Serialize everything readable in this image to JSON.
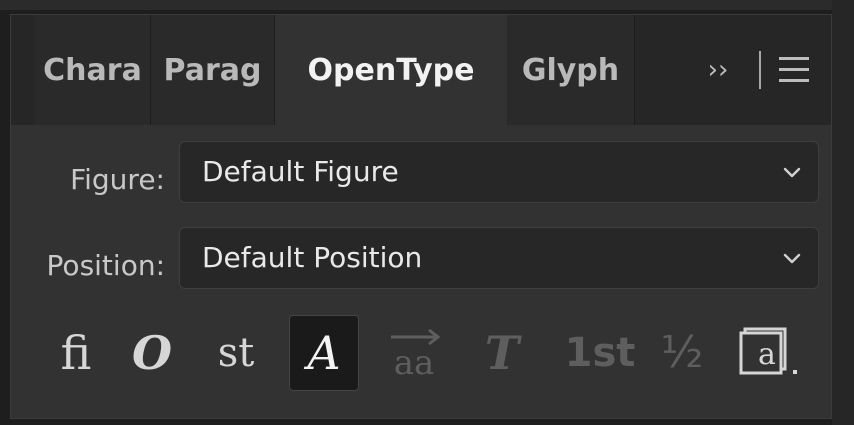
{
  "tabs": [
    {
      "label": "Chara",
      "active": false
    },
    {
      "label": "Parag",
      "active": false
    },
    {
      "label": "OpenType",
      "active": true
    },
    {
      "label": "Glyph",
      "active": false
    }
  ],
  "tab_overflow_glyph": "››",
  "panel_menu_icon": "hamburger-menu-icon",
  "figure": {
    "label": "Figure:",
    "value": "Default Figure"
  },
  "position": {
    "label": "Position:",
    "value": "Default Position"
  },
  "opentype_buttons": [
    {
      "name": "standard-ligatures",
      "glyph": "ﬁ",
      "enabled": true,
      "selected": false
    },
    {
      "name": "contextual-alternates",
      "glyph": "O",
      "enabled": true,
      "selected": false
    },
    {
      "name": "discretionary-ligatures",
      "glyph": "st",
      "enabled": true,
      "selected": false
    },
    {
      "name": "swash",
      "glyph": "A",
      "enabled": true,
      "selected": true
    },
    {
      "name": "stylistic-alternates",
      "glyph": "aa",
      "enabled": false,
      "selected": false
    },
    {
      "name": "titling-alternates",
      "glyph": "T",
      "enabled": false,
      "selected": false
    },
    {
      "name": "ordinals",
      "glyph": "1st",
      "enabled": false,
      "selected": false
    },
    {
      "name": "fractions",
      "glyph": "½",
      "enabled": false,
      "selected": false
    },
    {
      "name": "stylistic-sets",
      "glyph": "a",
      "enabled": true,
      "selected": false
    }
  ],
  "colors": {
    "panel_bg": "#323232",
    "tabbar_bg": "#262626",
    "field_bg": "#272727",
    "active_text": "#f2f2f2",
    "dim_icon": "#5e5e5e"
  }
}
